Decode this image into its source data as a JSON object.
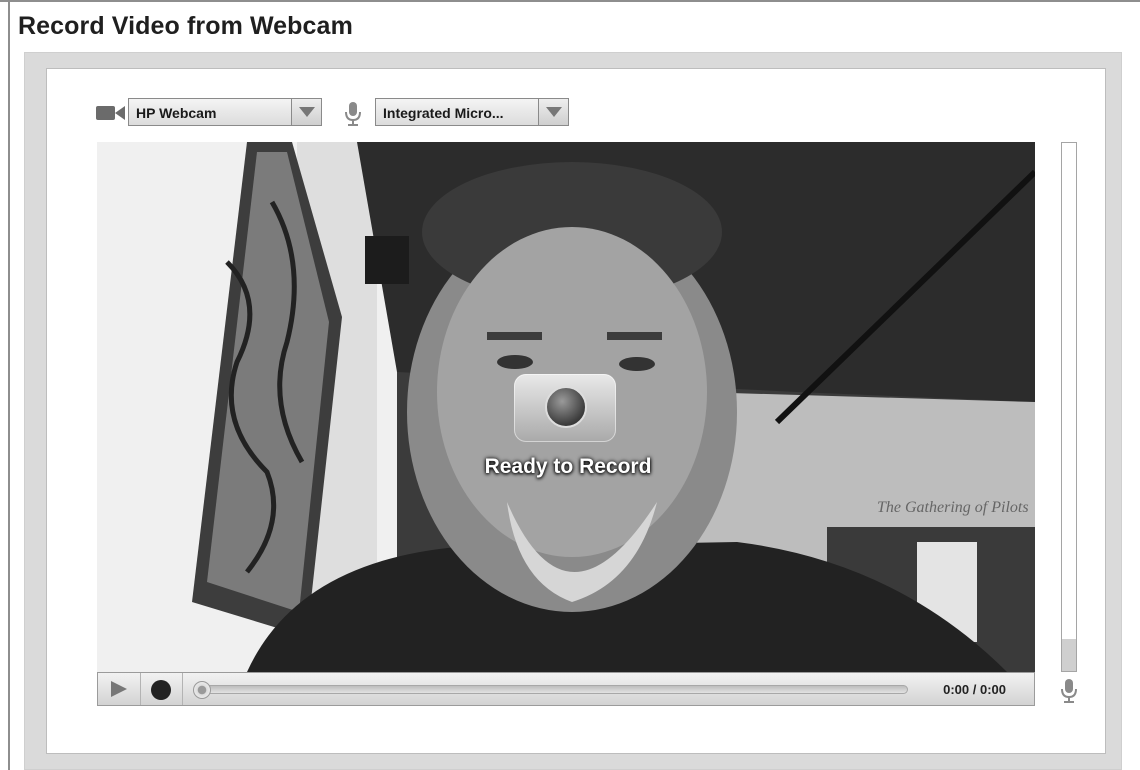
{
  "page": {
    "title": "Record Video from Webcam"
  },
  "devices": {
    "camera": {
      "icon": "video-camera-icon",
      "selected": "HP Webcam"
    },
    "microphone": {
      "icon": "microphone-icon",
      "selected": "Integrated Micro..."
    }
  },
  "recorder": {
    "status_text": "Ready to Record",
    "record_overlay_icon": "record-icon",
    "time_display": "0:00 / 0:00",
    "seek_progress": 0,
    "audio_level": 0.06
  },
  "controls": {
    "play_icon": "play-icon",
    "record_icon": "record-icon",
    "level_meter_icon": "microphone-icon"
  }
}
